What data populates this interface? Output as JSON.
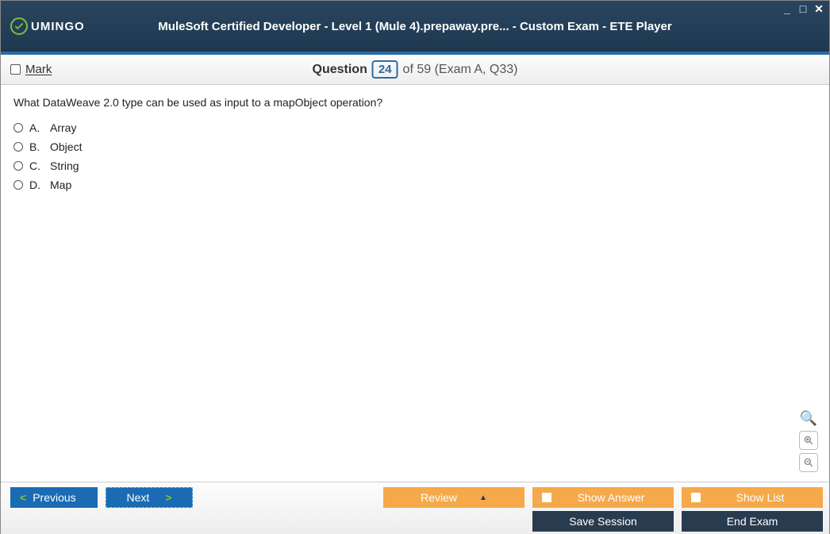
{
  "window": {
    "title": "MuleSoft Certified Developer - Level 1 (Mule 4).prepaway.pre... - Custom Exam - ETE Player",
    "logo_text": "UMINGO"
  },
  "subbar": {
    "mark_label": "Mark",
    "question_label": "Question",
    "question_number": "24",
    "question_total_info": "of 59 (Exam A, Q33)"
  },
  "question": {
    "text": "What DataWeave 2.0 type can be used as input to a mapObject operation?",
    "options": [
      {
        "letter": "A.",
        "text": "Array"
      },
      {
        "letter": "B.",
        "text": "Object"
      },
      {
        "letter": "C.",
        "text": "String"
      },
      {
        "letter": "D.",
        "text": "Map"
      }
    ]
  },
  "buttons": {
    "previous": "Previous",
    "next": "Next",
    "review": "Review",
    "show_answer": "Show Answer",
    "show_list": "Show List",
    "save_session": "Save Session",
    "end_exam": "End Exam"
  }
}
